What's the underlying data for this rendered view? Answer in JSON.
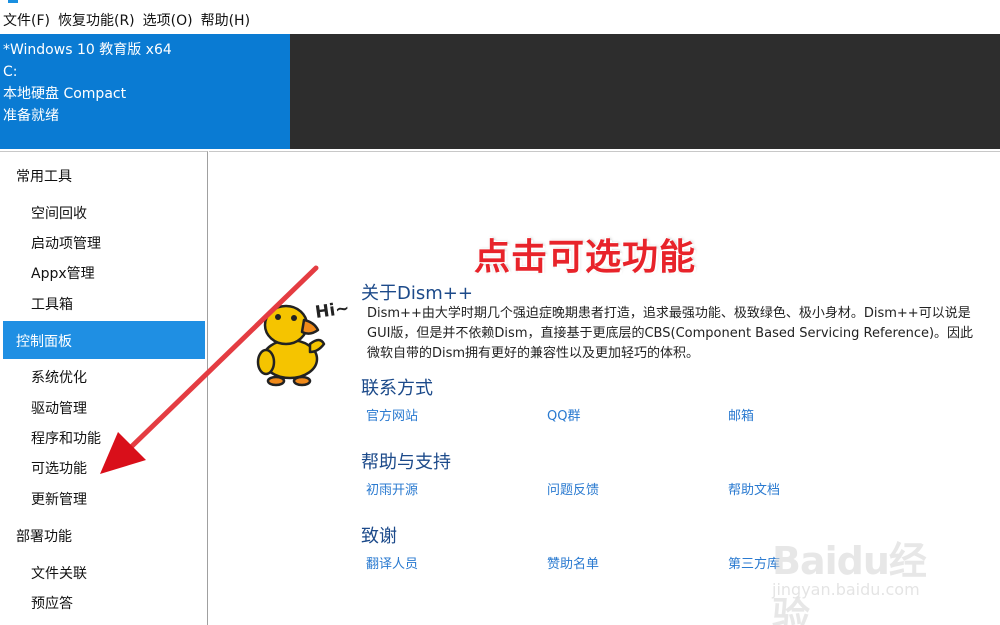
{
  "menu": {
    "file": "文件(F)",
    "restore": "恢复功能(R)",
    "options": "选项(O)",
    "help": "帮助(H)"
  },
  "system": {
    "os": "*Windows 10 教育版 x64",
    "drive": "C:",
    "disk": "本地硬盘 Compact",
    "status": "准备就绪"
  },
  "sidebar": {
    "groups": {
      "common": "常用工具",
      "control": "控制面板",
      "deploy": "部署功能"
    },
    "common_items": [
      "空间回收",
      "启动项管理",
      "Appx管理",
      "工具箱"
    ],
    "control_items": [
      "系统优化",
      "驱动管理",
      "程序和功能",
      "可选功能",
      "更新管理"
    ],
    "deploy_items": [
      "文件关联",
      "预应答"
    ]
  },
  "annotation": "点击可选功能",
  "about": {
    "title": "关于Dism++",
    "line1": "Dism++由大学时期几个强迫症晚期患者打造，追求最强功能、极致绿色、极小身材。Dism++可以说是",
    "line2": "GUI版，但是并不依赖Dism，直接基于更底层的CBS(Component Based Servicing Reference)。因此",
    "line3": "微软自带的Dism拥有更好的兼容性以及更加轻巧的体积。"
  },
  "contact": {
    "title": "联系方式",
    "links": [
      "官方网站",
      "QQ群",
      "邮箱"
    ]
  },
  "support": {
    "title": "帮助与支持",
    "links": [
      "初雨开源",
      "问题反馈",
      "帮助文档"
    ]
  },
  "thanks": {
    "title": "致谢",
    "links": [
      "翻译人员",
      "赞助名单",
      "第三方库"
    ]
  },
  "mascot": {
    "greeting": "Hi~"
  },
  "watermark": {
    "brand": "Baidu经验",
    "url": "jingyan.baidu.com"
  },
  "colors": {
    "accent": "#0a7bd3",
    "selected": "#1f8fe3",
    "annotation": "#e8232a",
    "link": "#2a7ad0"
  }
}
